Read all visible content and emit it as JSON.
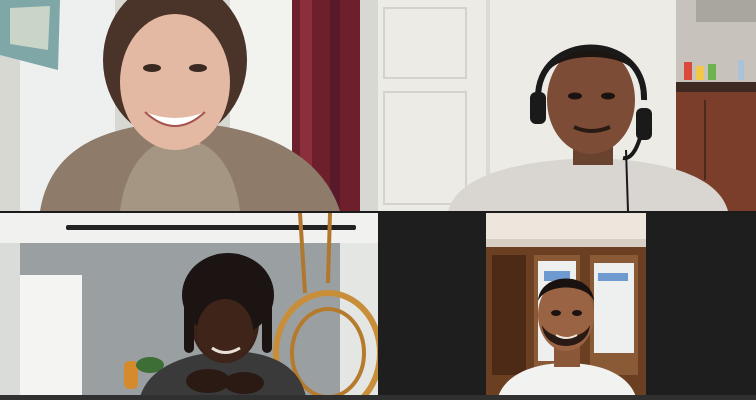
{
  "meeting": {
    "participants": [
      {
        "tile": "top-left"
      },
      {
        "tile": "top-right"
      },
      {
        "tile": "bottom-left"
      },
      {
        "tile": "bottom-right"
      }
    ]
  }
}
